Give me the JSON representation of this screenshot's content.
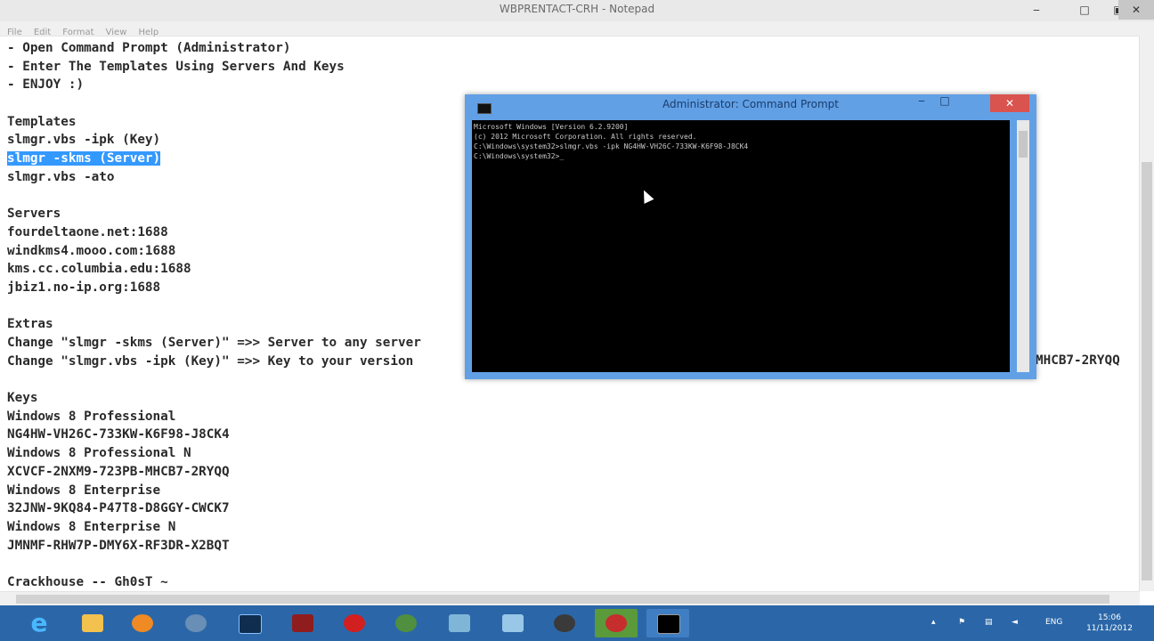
{
  "notepad": {
    "title": "WBPRENTACT-CRH - Notepad",
    "menu": [
      "File",
      "Edit",
      "Format",
      "View",
      "Help"
    ],
    "lines": [
      "- Open Command Prompt (Administrator)",
      "- Enter The Templates Using Servers And Keys",
      "- ENJOY :)",
      "",
      "Templates",
      "slmgr.vbs -ipk (Key)",
      "slmgr -skms (Server)",
      "slmgr.vbs -ato",
      "",
      "Servers",
      "fourdeltaone.net:1688",
      "windkms4.mooo.com:1688",
      "kms.cc.columbia.edu:1688",
      "jbiz1.no-ip.org:1688",
      "",
      "Extras",
      "Change \"slmgr -skms (Server)\" =>> Server to any server",
      "Change \"slmgr.vbs -ipk (Key)\" =>> Key to your version",
      "",
      "Keys",
      "Windows 8 Professional",
      "NG4HW-VH26C-733KW-K6F98-J8CK4",
      "Windows 8 Professional N",
      "XCVCF-2NXM9-723PB-MHCB7-2RYQQ",
      "Windows 8 Enterprise",
      "32JNW-9KQ84-P47T8-D8GGY-CWCK7",
      "Windows 8 Enterprise N",
      "JMNMF-RHW7P-DMY6X-RF3DR-X2BQT",
      "",
      "Crackhouse -- Gh0sT ~"
    ],
    "selected_line_index": 6,
    "overflow_tail": "MHCB7-2RYQQ"
  },
  "cmd": {
    "title": "Administrator: Command Prompt",
    "lines": [
      "Microsoft Windows [Version 6.2.9200]",
      "(c) 2012 Microsoft Corporation. All rights reserved.",
      "",
      "C:\\Windows\\system32>slmgr.vbs -ipk NG4HW-VH26C-733KW-K6F98-J8CK4",
      "",
      "C:\\Windows\\system32>_"
    ]
  },
  "taskbar": {
    "items": [
      "internet-explorer",
      "file-explorer",
      "media-player",
      "firefox",
      "photoshop",
      "app-red",
      "opera",
      "network-globe",
      "app-blue",
      "network",
      "app-eye",
      "app-green",
      "command-prompt"
    ],
    "colors": {
      "background": "#2b67a8",
      "ie": "#49b7ff",
      "selection": "#3399ff",
      "cmd_frame": "#62a0e6",
      "cmd_close": "#d9534f"
    },
    "tray": {
      "language": "ENG",
      "time": "15:06",
      "date": "11/11/2012"
    }
  }
}
